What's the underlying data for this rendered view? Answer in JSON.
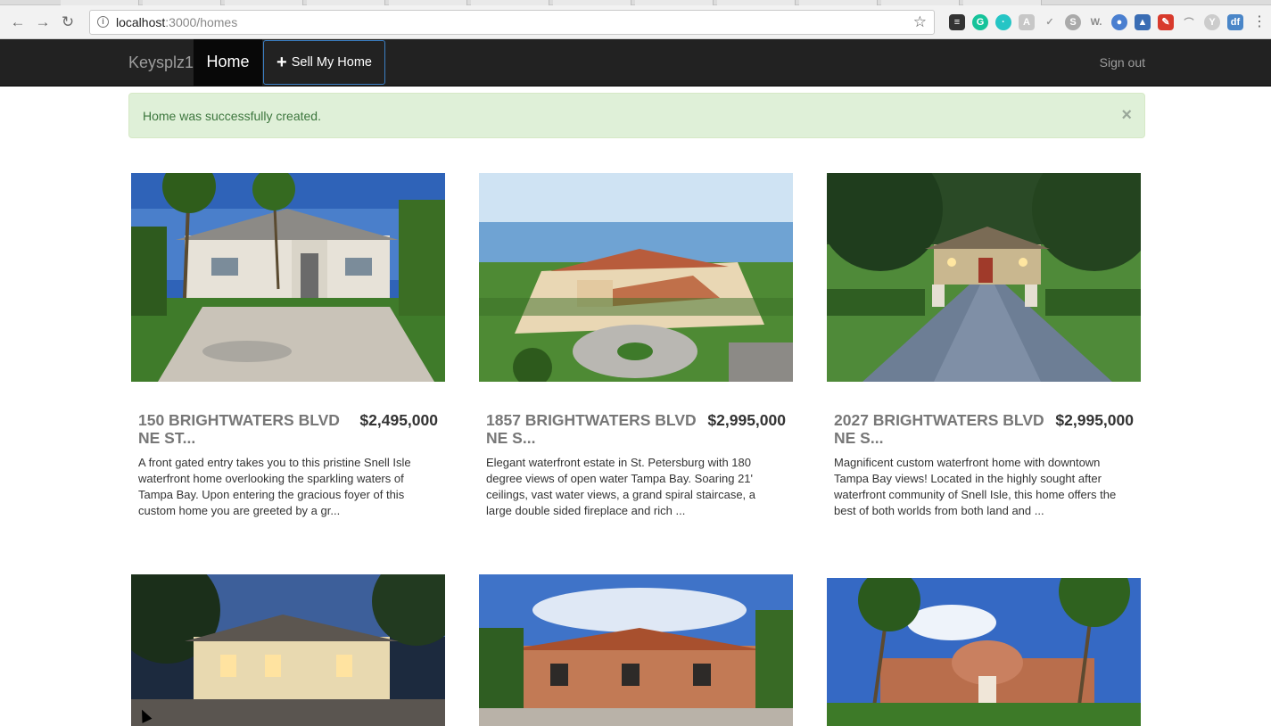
{
  "browser": {
    "url_host": "localhost",
    "url_path": ":3000/homes"
  },
  "navbar": {
    "brand": "Keysplz1",
    "home": "Home",
    "sell": "Sell My Home",
    "signout": "Sign out"
  },
  "alert": {
    "message": "Home was successfully created.",
    "close": "×"
  },
  "homes": [
    {
      "address": "150 BRIGHTWATERS BLVD NE ST...",
      "price": "$2,495,000",
      "description": "A front gated entry takes you to this pristine Snell Isle waterfront home overlooking the sparkling waters of Tampa Bay. Upon entering the gracious foyer of this custom home you are greeted by a gr..."
    },
    {
      "address": "1857 BRIGHTWATERS BLVD NE S...",
      "price": "$2,995,000",
      "description": "Elegant waterfront estate in St. Petersburg with 180 degree views of open water Tampa Bay. Soaring 21' ceilings, vast water views, a grand spiral staircase, a large double sided fireplace and rich ..."
    },
    {
      "address": "2027 BRIGHTWATERS BLVD NE S...",
      "price": "$2,995,000",
      "description": "Magnificent custom waterfront home with downtown Tampa Bay views! Located in the highly sought after waterfront community of Snell Isle, this home offers the best of both worlds from both land and ..."
    }
  ]
}
